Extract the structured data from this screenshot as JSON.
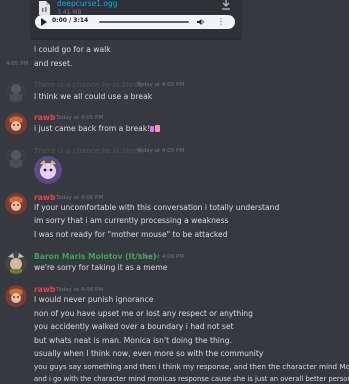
{
  "attachment": {
    "filename": "deepcurse1.ogg",
    "size": "3.41 MB",
    "player_time": "0:00 / 3:14"
  },
  "messages": {
    "m1": "i could go for a walk",
    "m2_time": "4:05 PM",
    "m2": "and reset.",
    "blocked1_name": "There is a chance he is Shrek",
    "blocked1_time": "Today at 4:05 PM",
    "blocked1_text": "I think we all could use a break",
    "rawb1_name": "rawb",
    "rawb1_time": "Today at 4:05 PM",
    "rawb1_text": "i just came back from a break!",
    "blocked2_name": "There is a chance he is Shrek",
    "blocked2_time": "Today at 4:05 PM",
    "rawb2_name": "rawb",
    "rawb2_time": "Today at 4:06 PM",
    "rawb2_lines": [
      "if your uncomfortable with this conversation i totally understand",
      "im sorry that i am currently processing a weakness",
      "I was not ready for \"mother mouse\" to be attacked"
    ],
    "baron_name": "Baron Maris Molotov (It/she)",
    "baron_time": "Today at 4:06 PM",
    "baron_text": "we're sorry for taking it as a meme",
    "rawb3_name": "rawb",
    "rawb3_time": "Today at 4:06 PM",
    "rawb3_lines": [
      "I would never punish ignorance",
      "non of you have upset me or lost any respect or anything",
      "you accidently walked over a boundary i had not set",
      "but whats neat is man. Monica isn't doing the thing.",
      "usually when I think now, even more so with the community",
      "you guys say something and then i think my response, and then the character mind Monica",
      "and i go with the character mind monicas response cause she is just an overall better person"
    ]
  },
  "colors": {
    "background": "#36393f",
    "rawb": "#ed4245",
    "baron": "#3ba55d",
    "link": "#00b0f4",
    "muted": "#72767d"
  }
}
